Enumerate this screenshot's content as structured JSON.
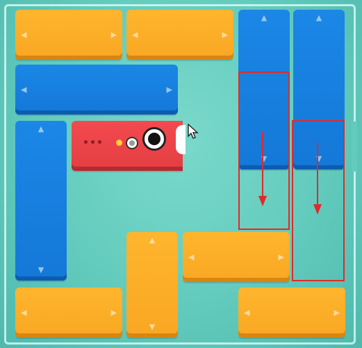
{
  "game": {
    "title": "",
    "colors": {
      "orange_block": "#f9a722",
      "blue_block": "#1478d8",
      "red_target": "#e43d42",
      "board_bg": "#63cbbd",
      "hint_annotation": "#e02a2a"
    },
    "icons": {
      "horizontal_arrows": "triangle-left/right",
      "vertical_arrows": "triangle-up/down",
      "cursor": "mouse-pointer-icon"
    },
    "arrow_glyphs": {
      "left": "◀",
      "right": "▶",
      "up": "▲",
      "down": "▼"
    },
    "blocks": [
      {
        "id": "orange-h-1",
        "color": "orange",
        "orientation": "horizontal",
        "length": 2
      },
      {
        "id": "orange-h-2",
        "color": "orange",
        "orientation": "horizontal",
        "length": 2
      },
      {
        "id": "blue-v-1",
        "color": "blue",
        "orientation": "vertical",
        "length": 3
      },
      {
        "id": "blue-v-2",
        "color": "blue",
        "orientation": "vertical",
        "length": 3
      },
      {
        "id": "blue-h-1",
        "color": "blue",
        "orientation": "horizontal",
        "length": 3
      },
      {
        "id": "red-target",
        "color": "red",
        "orientation": "horizontal",
        "length": 2
      },
      {
        "id": "blue-v-3",
        "color": "blue",
        "orientation": "vertical",
        "length": 3
      },
      {
        "id": "orange-v-1",
        "color": "orange",
        "orientation": "vertical",
        "length": 2
      },
      {
        "id": "orange-h-3",
        "color": "orange",
        "orientation": "horizontal",
        "length": 2
      },
      {
        "id": "orange-h-4",
        "color": "orange",
        "orientation": "horizontal",
        "length": 2
      },
      {
        "id": "orange-h-5",
        "color": "orange",
        "orientation": "horizontal",
        "length": 2
      }
    ],
    "hints": [
      {
        "id": "hint-move-down-1",
        "direction": "down"
      },
      {
        "id": "hint-move-down-2",
        "direction": "down"
      }
    ]
  }
}
